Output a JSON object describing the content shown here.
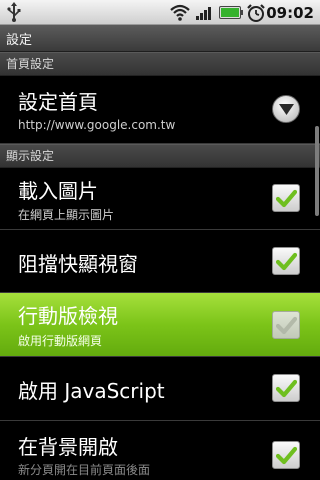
{
  "status_bar": {
    "time": "09:02",
    "icons": [
      "usb-icon",
      "wifi-icon",
      "signal-icon",
      "battery-icon",
      "alarm-icon"
    ]
  },
  "title_bar": {
    "title": "設定"
  },
  "sections": [
    {
      "header": "首頁設定",
      "items": [
        {
          "title": "設定首頁",
          "summary": "http://www.google.com.tw",
          "widget": "dropdown-icon"
        }
      ]
    },
    {
      "header": "顯示設定",
      "items": [
        {
          "title": "載入圖片",
          "summary": "在網頁上顯示圖片",
          "checked": true
        },
        {
          "title": "阻擋快顯視窗",
          "summary": "",
          "checked": true
        },
        {
          "title": "行動版檢視",
          "summary": "啟用行動版網頁",
          "checked": true,
          "selected": true
        },
        {
          "title": "啟用 JavaScript",
          "summary": "",
          "checked": true
        },
        {
          "title": "在背景開啟",
          "summary": "新分頁開在目前頁面後面",
          "checked": true
        }
      ]
    }
  ],
  "colors": {
    "selection_green": "#7cc419",
    "check_green": "#6fbf1f",
    "category_bg": "#3f3f3f"
  }
}
